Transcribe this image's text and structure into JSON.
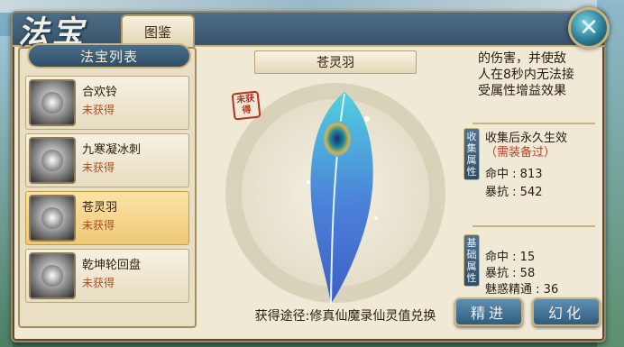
{
  "window": {
    "title_logo": "法宝",
    "tab_label": "图鉴",
    "close_symbol": "✕"
  },
  "list": {
    "header": "法宝列表",
    "items": [
      {
        "name": "合欢铃",
        "status": "未获得",
        "selected": false
      },
      {
        "name": "九寒凝冰刺",
        "status": "未获得",
        "selected": false
      },
      {
        "name": "苍灵羽",
        "status": "未获得",
        "selected": true
      },
      {
        "name": "乾坤轮回盘",
        "status": "未获得",
        "selected": false
      }
    ]
  },
  "detail": {
    "name": "苍灵羽",
    "seal_text": "未获得",
    "obtain_text": "获得途径:修真仙魔录仙灵值兑换"
  },
  "info": {
    "desc_lines": [
      "的伤害，并使敌",
      "人在8秒内无法接",
      "受属性增益效果"
    ],
    "collect": {
      "label": "收集属性",
      "note": "收集后永久生效",
      "requirement": "（需装备过）",
      "stats": [
        {
          "name": "命中",
          "value": "813"
        },
        {
          "name": "暴抗",
          "value": "542"
        }
      ]
    },
    "base": {
      "label": "基础属性",
      "stats": [
        {
          "name": "命中",
          "value": "15"
        },
        {
          "name": "暴抗",
          "value": "58"
        },
        {
          "name": "魅惑精通",
          "value": "36"
        }
      ]
    }
  },
  "buttons": {
    "refine": "精进",
    "transform": "幻化"
  },
  "colors": {
    "accent_gold": "#c9b37a",
    "title_blue": "#37536a",
    "status_red": "#b04a1e"
  }
}
